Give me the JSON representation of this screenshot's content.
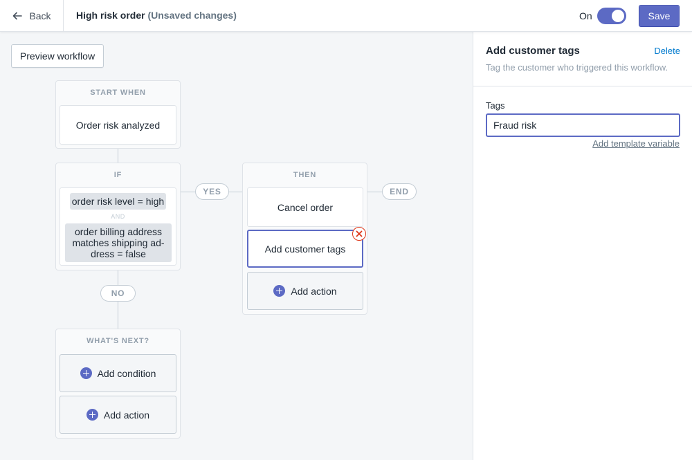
{
  "header": {
    "back_label": "Back",
    "title": "High risk order",
    "title_status": "(Unsaved changes)",
    "toggle_label": "On",
    "save_label": "Save"
  },
  "canvas": {
    "preview_label": "Preview workflow",
    "start": {
      "heading": "START WHEN",
      "trigger": "Order risk analyzed"
    },
    "condition": {
      "heading": "IF",
      "clause_1": "order risk level =  high",
      "joiner": "AND",
      "clause_2": "order billing address matches shipping ad-dress = false"
    },
    "yes_label": "YES",
    "no_label": "NO",
    "end_label": "END",
    "then": {
      "heading": "THEN",
      "actions": [
        "Cancel order",
        "Add customer tags"
      ],
      "add_action_label": "Add action"
    },
    "next": {
      "heading": "WHAT'S NEXT?",
      "add_condition_label": "Add condition",
      "add_action_label": "Add action"
    }
  },
  "panel": {
    "title": "Add customer tags",
    "delete_label": "Delete",
    "description": "Tag the customer who triggered this workflow.",
    "field_label": "Tags",
    "field_value": "Fraud risk",
    "template_link": "Add template variable"
  },
  "colors": {
    "accent": "#5c6ac4",
    "link": "#007ace",
    "danger": "#de3618"
  },
  "icons": {
    "back": "arrow-left-icon",
    "add": "plus-circle-icon",
    "remove": "close-circle-icon"
  }
}
